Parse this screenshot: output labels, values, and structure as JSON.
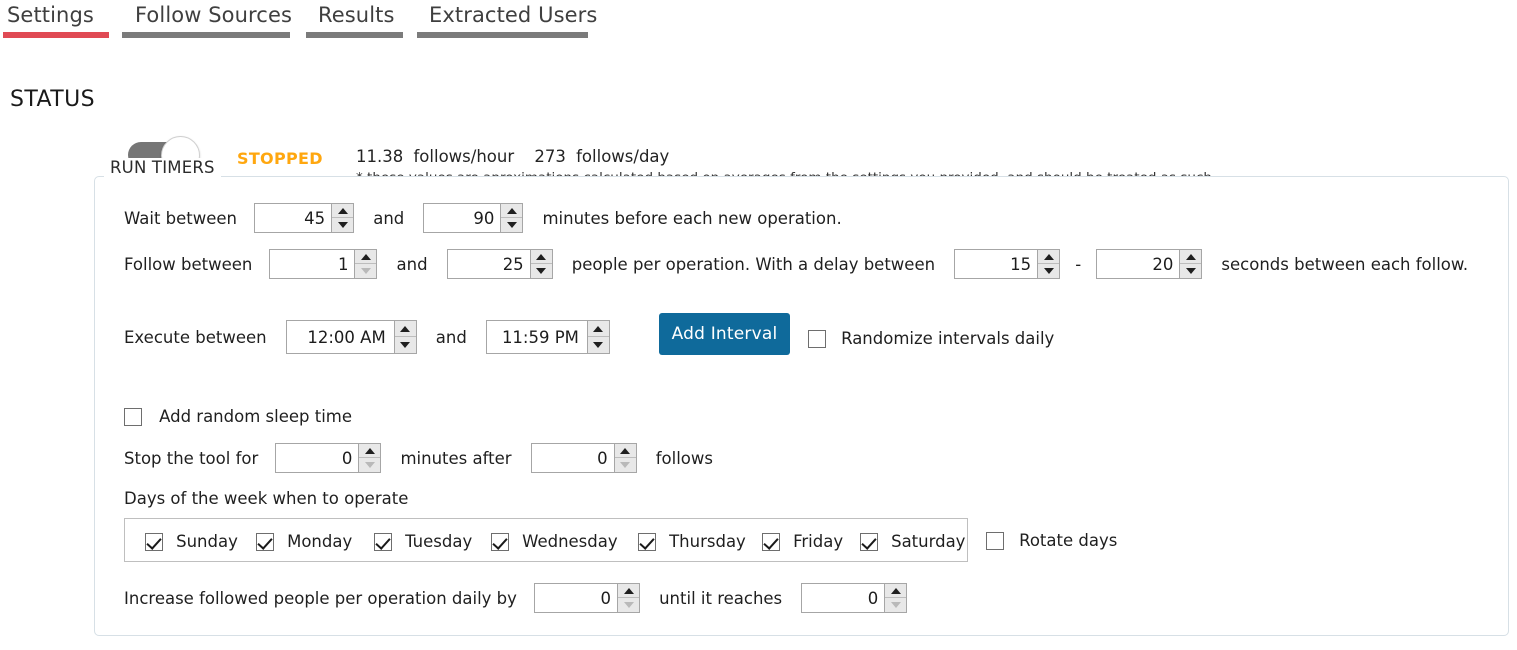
{
  "tabs": [
    {
      "label": "Settings",
      "active": true
    },
    {
      "label": "Follow Sources",
      "active": false
    },
    {
      "label": "Results",
      "active": false
    },
    {
      "label": "Extracted Users",
      "active": false
    }
  ],
  "status": {
    "label": "STATUS",
    "toggle_state": "off",
    "state_text": "STOPPED",
    "rate_hour_value": "11.38",
    "rate_hour_unit": "follows/hour",
    "rate_day_value": "273",
    "rate_day_unit": "follows/day",
    "note": "* these values are aproximations calculated based on averages from the settings you provided, and should be treated as such",
    "accent_color": "#ffa70f"
  },
  "run_timers": {
    "title": "RUN TIMERS",
    "wait": {
      "prefix": "Wait between",
      "min": "45",
      "conjunction": "and",
      "max": "90",
      "suffix": "minutes before each new operation."
    },
    "follow": {
      "prefix": "Follow between",
      "min": "1",
      "conjunction": "and",
      "max": "25",
      "middle": "people per operation. With a delay between",
      "delay_min": "15",
      "dash": "-",
      "delay_max": "20",
      "suffix": "seconds between each follow."
    },
    "execute": {
      "prefix": "Execute between",
      "start_time": "12:00 AM",
      "conjunction": "and",
      "end_time": "11:59 PM",
      "add_interval_label": "Add Interval",
      "randomize_label": "Randomize intervals daily",
      "randomize_checked": false
    },
    "sleep": {
      "random_sleep_label": "Add random sleep time",
      "random_sleep_checked": false,
      "stop_prefix": "Stop the tool for",
      "stop_minutes": "0",
      "stop_middle": "minutes after",
      "stop_follows": "0",
      "stop_suffix": "follows"
    },
    "days": {
      "caption": "Days of the week when to operate",
      "items": [
        {
          "label": "Sunday",
          "checked": true
        },
        {
          "label": "Monday",
          "checked": true
        },
        {
          "label": "Tuesday",
          "checked": true
        },
        {
          "label": "Wednesday",
          "checked": true
        },
        {
          "label": "Thursday",
          "checked": true
        },
        {
          "label": "Friday",
          "checked": true
        },
        {
          "label": "Saturday",
          "checked": true
        }
      ],
      "rotate_label": "Rotate days",
      "rotate_checked": false
    },
    "increase": {
      "prefix": "Increase followed people per operation daily by",
      "by_value": "0",
      "middle": "until it reaches",
      "until_value": "0"
    }
  },
  "colors": {
    "active_tab_underline": "#e04a54",
    "inactive_tab_underline": "#7b7b7b",
    "primary_button": "#0f6a9b"
  }
}
